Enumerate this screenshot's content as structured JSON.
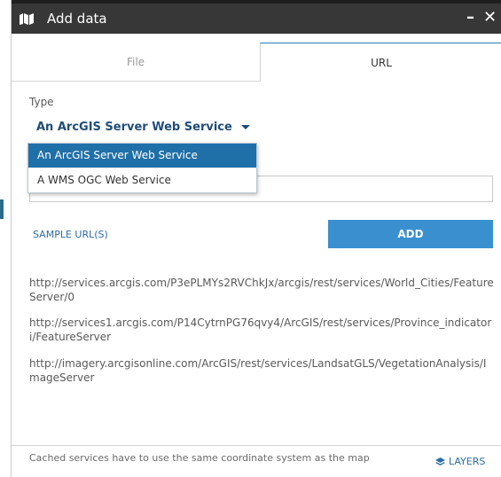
{
  "window": {
    "title": "Add data",
    "minimize_symbol": "–",
    "close_symbol": "✕",
    "icon": "map-icon"
  },
  "tabs": [
    {
      "label": "File",
      "active": false
    },
    {
      "label": "URL",
      "active": true
    }
  ],
  "form": {
    "type_label": "Type",
    "selected_type": "An ArcGIS Server Web Service",
    "dropdown_options": [
      "An ArcGIS Server Web Service",
      "A WMS OGC Web Service"
    ],
    "url_value": "",
    "sample_link": "SAMPLE URL(S)",
    "add_button": "ADD"
  },
  "sample_urls": [
    "http://services.arcgis.com/P3ePLMYs2RVChkJx/arcgis/rest/services/World_Cities/FeatureServer/0",
    "http://services1.arcgis.com/P14CytrnPG76qvy4/ArcGIS/rest/services/Province_indicatori/FeatureServer",
    "http://imagery.arcgisonline.com/ArcGIS/rest/services/LandsatGLS/VegetationAnalysis/ImageServer"
  ],
  "footer": {
    "note": "Cached services have to use the same coordinate system as the map",
    "layers_link": "LAYERS",
    "layers_icon": "layers-icon"
  },
  "colors": {
    "titlebar": "#373737",
    "accent": "#3a8fcf",
    "selected_option": "#1f6fa8",
    "link": "#2e6da4"
  }
}
